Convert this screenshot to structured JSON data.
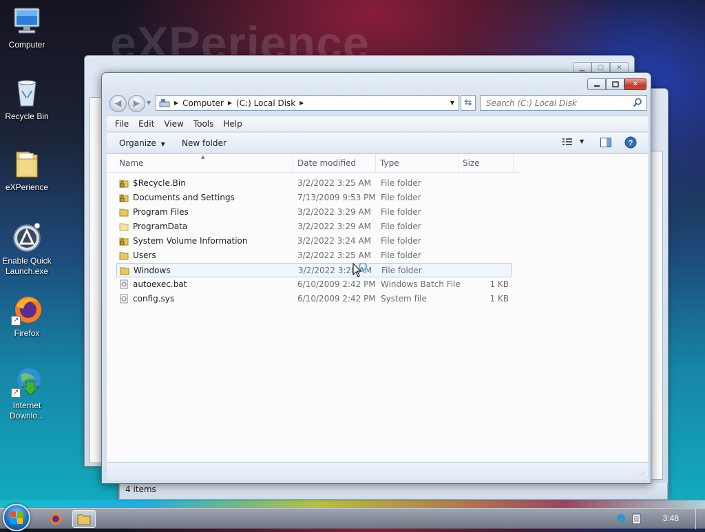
{
  "desktop": {
    "watermark": "eXPerience",
    "icons": [
      {
        "label": "Computer",
        "icon": "computer-icon"
      },
      {
        "label": "Recycle Bin",
        "icon": "recycle-bin-icon"
      },
      {
        "label": "eXPerience",
        "icon": "folder-icon"
      },
      {
        "label": "Enable Quick Launch.exe",
        "icon": "app-icon"
      },
      {
        "label": "Firefox",
        "icon": "firefox-icon"
      },
      {
        "label": "Internet Downlo...",
        "icon": "download-manager-icon"
      }
    ]
  },
  "explorer": {
    "breadcrumb": [
      "Computer",
      "(C:) Local Disk"
    ],
    "search_placeholder": "Search (C:) Local Disk",
    "menu": [
      "File",
      "Edit",
      "View",
      "Tools",
      "Help"
    ],
    "commands": {
      "organize": "Organize",
      "new_folder": "New folder"
    },
    "columns": {
      "name": "Name",
      "date": "Date modified",
      "type": "Type",
      "size": "Size"
    },
    "files": [
      {
        "name": "$Recycle.Bin",
        "date": "3/2/2022 3:25 AM",
        "type": "File folder",
        "size": "",
        "icon": "locked-folder-icon"
      },
      {
        "name": "Documents and Settings",
        "date": "7/13/2009 9:53 PM",
        "type": "File folder",
        "size": "",
        "icon": "locked-folder-icon"
      },
      {
        "name": "Program Files",
        "date": "3/2/2022 3:29 AM",
        "type": "File folder",
        "size": "",
        "icon": "folder-icon"
      },
      {
        "name": "ProgramData",
        "date": "3/2/2022 3:29 AM",
        "type": "File folder",
        "size": "",
        "icon": "folder-icon"
      },
      {
        "name": "System Volume Information",
        "date": "3/2/2022 3:24 AM",
        "type": "File folder",
        "size": "",
        "icon": "locked-folder-icon"
      },
      {
        "name": "Users",
        "date": "3/2/2022 3:25 AM",
        "type": "File folder",
        "size": "",
        "icon": "folder-icon"
      },
      {
        "name": "Windows",
        "date": "3/2/2022 3:28 AM",
        "type": "File folder",
        "size": "",
        "icon": "folder-icon",
        "selected": true
      },
      {
        "name": "autoexec.bat",
        "date": "6/10/2009 2:42 PM",
        "type": "Windows Batch File",
        "size": "1 KB",
        "icon": "batch-file-icon"
      },
      {
        "name": "config.sys",
        "date": "6/10/2009 2:42 PM",
        "type": "System file",
        "size": "1 KB",
        "icon": "system-file-icon"
      }
    ],
    "status_back": "4 items"
  },
  "taskbar": {
    "clock": "3:48"
  }
}
